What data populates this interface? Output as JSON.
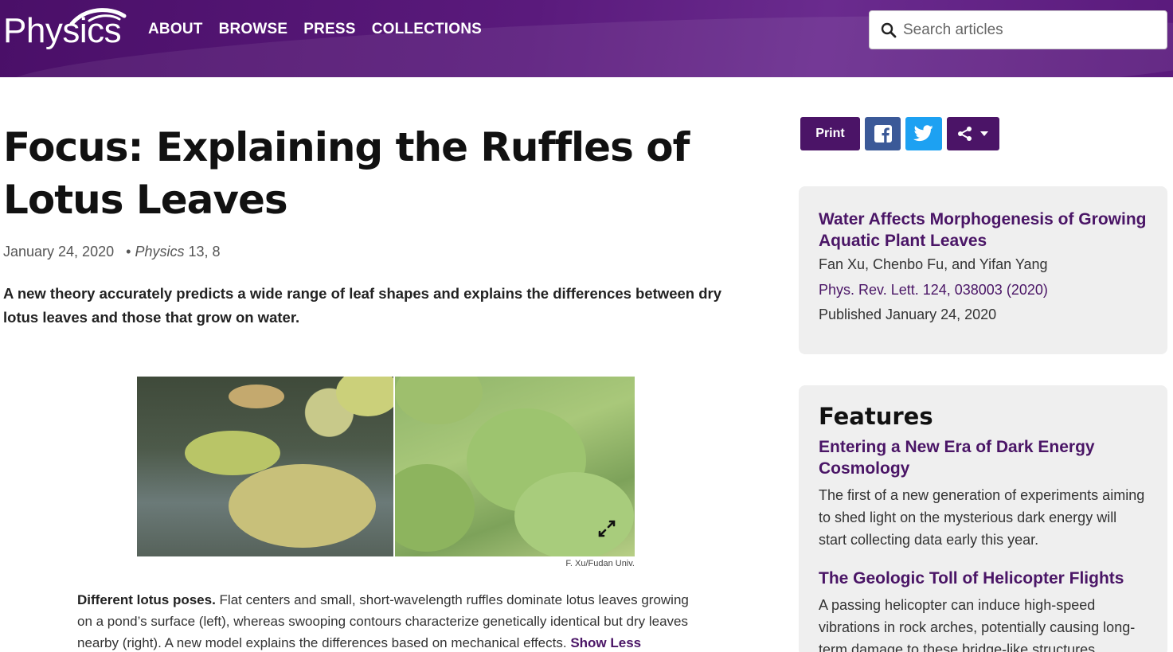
{
  "header": {
    "logo_text": "Physics",
    "nav": [
      "ABOUT",
      "BROWSE",
      "PRESS",
      "COLLECTIONS"
    ],
    "search_placeholder": "Search articles"
  },
  "article": {
    "title": "Focus: Explaining the Ruffles of Lotus Leaves",
    "date": "January 24, 2020",
    "journal_name": "Physics",
    "journal_ref": "13, 8",
    "teaser": "A new theory accurately predicts a wide range of leaf shapes and explains the differences between dry lotus leaves and those that grow on water.",
    "figure_credit": "F. Xu/Fudan Univ.",
    "caption_lead": "Different lotus poses.",
    "caption_text": "Flat centers and small, short-wavelength ruffles dominate lotus leaves growing on a pond’s surface (left), whereas swooping contours characterize genetically identical but dry leaves nearby (right). A new model explains the differences based on mechanical effects.",
    "caption_toggle": "Show Less"
  },
  "share": {
    "print_label": "Print",
    "icons": [
      "facebook-icon",
      "twitter-icon",
      "share-icon",
      "caret-down-icon"
    ]
  },
  "related": {
    "title": "Water Affects Morphogenesis of Growing Aquatic Plant Leaves",
    "authors": "Fan Xu, Chenbo Fu, and Yifan Yang",
    "journal": "Phys. Rev. Lett. 124, 038003 (2020)",
    "published": "Published January 24, 2020"
  },
  "features": {
    "heading": "Features",
    "items": [
      {
        "title": "Entering a New Era of Dark Energy Cosmology",
        "summary": "The first of a new generation of experiments aiming to shed light on the mysterious dark energy will start collecting data early this year."
      },
      {
        "title": "The Geologic Toll of Helicopter Flights",
        "summary": "A passing helicopter can induce high-speed vibrations in rock arches, potentially causing long-term damage to these bridge-like structures."
      }
    ]
  },
  "colors": {
    "brand_purple": "#4b1467",
    "link_purple": "#4a1566",
    "facebook": "#3b5998",
    "twitter": "#1da1f2",
    "sidebar_bg": "#efefef"
  }
}
